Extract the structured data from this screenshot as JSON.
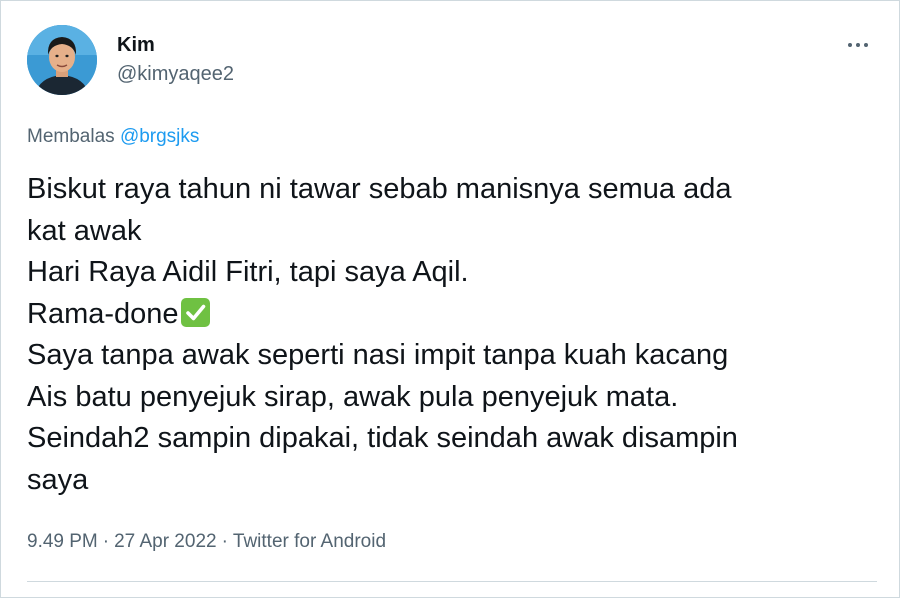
{
  "tweet": {
    "author": {
      "name": "Kim",
      "handle": "@kimyaqee2",
      "avatar_icon": "profile-photo"
    },
    "more_icon": "ellipsis-icon",
    "reply": {
      "prefix": "Membalas",
      "mention": "@brgsjks"
    },
    "lines": [
      "Biskut raya tahun ni tawar sebab manisnya semua ada",
      "kat awak",
      "Hari Raya Aidil Fitri, tapi saya Aqil.",
      "Rama-done",
      "Saya tanpa awak seperti nasi impit tanpa kuah kacang",
      "Ais batu penyejuk sirap, awak pula penyejuk mata.",
      "Seindah2 sampin dipakai, tidak seindah awak disampin",
      "saya"
    ],
    "emoji": "check-mark-button-icon",
    "meta": {
      "time": "9.49 PM",
      "separator": "·",
      "date": "27 Apr 2022",
      "source": "Twitter for Android"
    }
  },
  "colors": {
    "text": "#0f1419",
    "secondary": "#536471",
    "link": "#1d9bf0",
    "emoji_green": "#6fc142",
    "border": "#cfd9de"
  }
}
